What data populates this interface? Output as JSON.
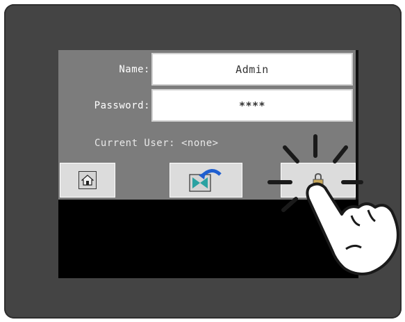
{
  "login": {
    "name_label": "Name:",
    "name_value": "Admin",
    "password_label": "Password:",
    "password_value": "****",
    "current_user": "Current User: <none>"
  },
  "buttons": [
    {
      "icon": "home-icon"
    },
    {
      "icon": "exit-screen-icon"
    },
    {
      "icon": "logout-icon"
    }
  ],
  "colors": {
    "bezel": "#444444",
    "panel": "#7c7c7c",
    "button": "#dcdcdc",
    "accent_blue": "#1f5fd0",
    "icon_teal": "#2aa2a2"
  }
}
